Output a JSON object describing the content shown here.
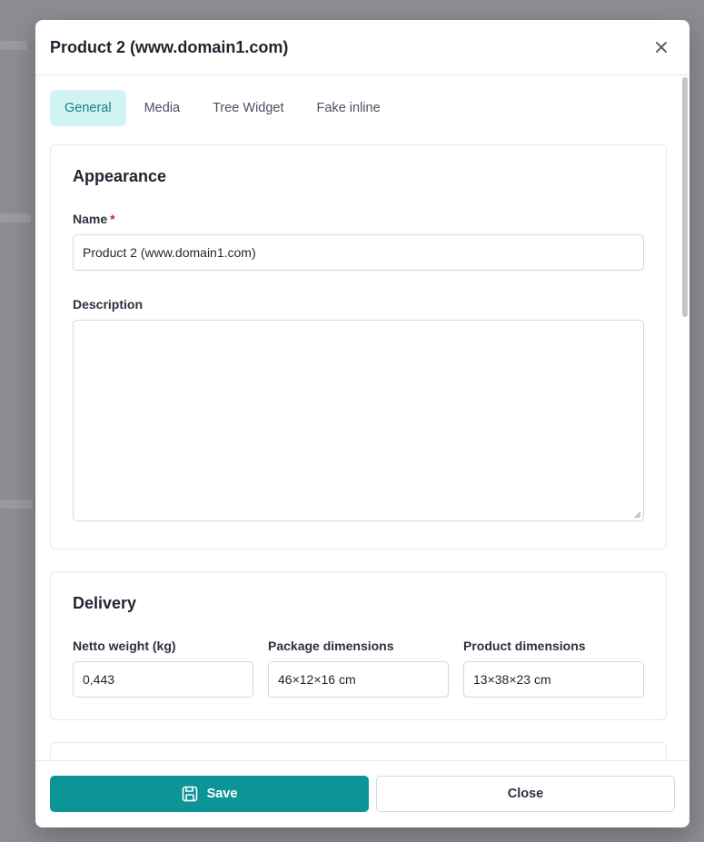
{
  "modal": {
    "title": "Product 2 (www.domain1.com)"
  },
  "tabs": [
    {
      "label": "General",
      "active": true
    },
    {
      "label": "Media",
      "active": false
    },
    {
      "label": "Tree Widget",
      "active": false
    },
    {
      "label": "Fake inline",
      "active": false
    }
  ],
  "appearance": {
    "title": "Appearance",
    "name_label": "Name",
    "required_mark": "*",
    "name_value": "Product 2 (www.domain1.com)",
    "description_label": "Description",
    "description_value": ""
  },
  "delivery": {
    "title": "Delivery",
    "netto_weight_label": "Netto weight (kg)",
    "netto_weight_value": "0,443",
    "package_dimensions_label": "Package dimensions",
    "package_dimensions_value": "46×12×16 cm",
    "product_dimensions_label": "Product dimensions",
    "product_dimensions_value": "13×38×23 cm"
  },
  "footer": {
    "save_label": "Save",
    "close_label": "Close"
  },
  "colors": {
    "accent": "#0c9497",
    "tab_active_bg": "#d2f3f3",
    "required": "#d0242b",
    "overlay": "#8c8d93"
  },
  "icons": {
    "close": "close-icon",
    "save": "save-icon"
  }
}
